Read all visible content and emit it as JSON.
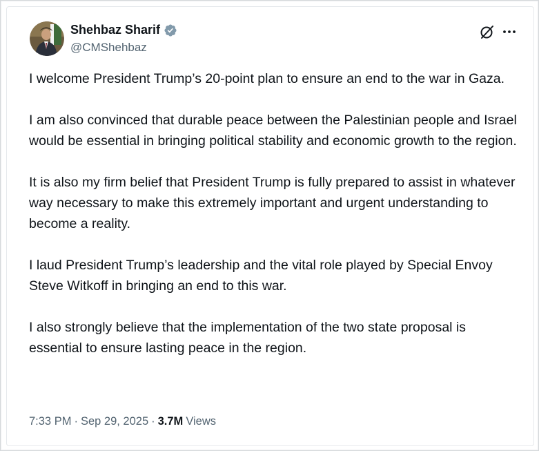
{
  "author": {
    "display_name": "Shehbaz Sharif",
    "handle": "@CMShehbaz",
    "verified_icon": "verified-badge-icon",
    "verified_color": "#829aab"
  },
  "header_actions": {
    "grok_icon": "grok-icon",
    "more_icon": "more-options-icon"
  },
  "tweet": {
    "paragraphs": [
      "I welcome President Trump’s 20-point plan to ensure an end to the war in Gaza.",
      "I am also convinced that durable peace between the Palestinian people and Israel would be essential in bringing political stability and economic growth to the region.",
      "It is also my firm belief that President Trump is fully prepared to assist in whatever way necessary to make this extremely important and urgent understanding to become a reality.",
      "I laud President Trump’s leadership and the vital role played by Special Envoy Steve Witkoff in bringing an end to this war.",
      "I also strongly believe that the implementation of the two state proposal is essential to ensure lasting peace in the region."
    ]
  },
  "meta": {
    "time": "7:33 PM",
    "separator": "·",
    "date": "Sep 29, 2025",
    "views_count": "3.7M",
    "views_label": "Views"
  },
  "colors": {
    "text_primary": "#0f1419",
    "text_secondary": "#536471"
  }
}
